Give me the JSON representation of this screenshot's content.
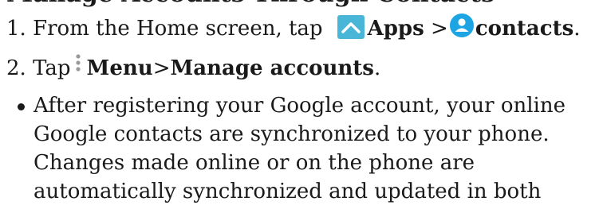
{
  "heading": "Manage Accounts Through Contacts",
  "step1": {
    "number": "1.",
    "text_before": "From the Home screen, tap",
    "apps_icon": "chevron-up-icon",
    "apps_label": "Apps",
    "separator": ">",
    "contacts_icon": "contacts-person-icon",
    "contacts_label": "contacts",
    "period": "."
  },
  "step2": {
    "number": "2.",
    "tap": "Tap",
    "menu_icon": "more-vertical-icon",
    "menu_label": "Menu",
    "separator": ">",
    "manage_label": "Manage accounts",
    "period": "."
  },
  "bullet": {
    "lines": [
      "After registering your Google account, your online",
      "Google contacts are synchronized to your phone.",
      "Changes made online or on the phone are",
      "automatically synchronized and updated in both"
    ]
  },
  "colors": {
    "text": "#1a1a1a",
    "apps_icon_bg": "#49b6d8",
    "contacts_icon_bg": "#1ca4e3"
  }
}
